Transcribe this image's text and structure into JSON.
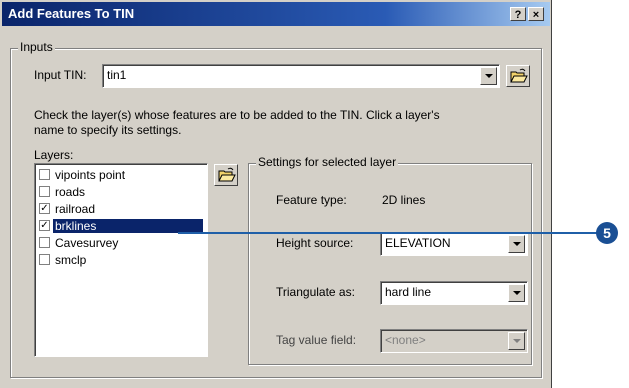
{
  "window": {
    "title": "Add Features To TIN",
    "help_button": "?",
    "close_button": "×"
  },
  "inputs": {
    "group_label": "Inputs",
    "input_tin_label": "Input TIN:",
    "input_tin_value": "tin1",
    "instructions_line1": "Check the layer(s) whose features are to be added to the TIN. Click a layer's",
    "instructions_line2": "name to specify its settings.",
    "layers_label": "Layers:"
  },
  "layers": [
    {
      "label": "vipoints point",
      "checked": false,
      "mark": ""
    },
    {
      "label": "roads",
      "checked": false,
      "mark": ""
    },
    {
      "label": "railroad",
      "checked": true,
      "mark": "✓"
    },
    {
      "label": "brklines",
      "checked": true,
      "mark": "✓",
      "selected": true
    },
    {
      "label": "Cavesurvey",
      "checked": false,
      "mark": ""
    },
    {
      "label": "smclp",
      "checked": false,
      "mark": ""
    }
  ],
  "settings": {
    "group_label": "Settings for selected layer",
    "feature_type_label": "Feature type:",
    "feature_type_value": "2D lines",
    "height_source_label": "Height source:",
    "height_source_value": "ELEVATION",
    "triangulate_label": "Triangulate as:",
    "triangulate_value": "hard line",
    "tag_value_label": "Tag value field:",
    "tag_value_value": "<none>"
  },
  "callout": {
    "number": "5"
  },
  "colors": {
    "title_start": "#0a246a",
    "selection": "#0a246a",
    "callout": "#1a4f94",
    "dialog_bg": "#d4d0c8"
  }
}
